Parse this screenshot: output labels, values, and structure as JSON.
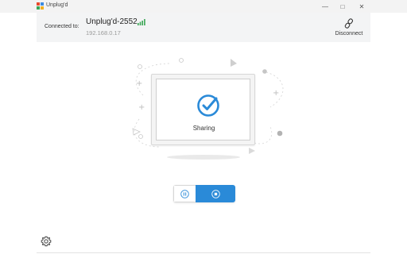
{
  "window": {
    "title": "Unplug'd",
    "logo_colors": [
      "#e8492e",
      "#3d8be0",
      "#3aa655",
      "#f2b01e"
    ],
    "minimize_icon": "minimize-icon",
    "maximize_icon": "maximize-icon",
    "close_icon": "close-icon"
  },
  "header": {
    "connected_label": "Connected to:",
    "device_name": "Unplug'd-2552",
    "ip_address": "192.168.0.17",
    "signal_icon": "signal-strength-icon",
    "signal_color": "#3aa655",
    "disconnect_label": "Disconnect",
    "disconnect_icon": "unlink-icon"
  },
  "main": {
    "status_text": "Sharing",
    "status_icon": "check-circle-icon",
    "accent_color": "#2a8ad8"
  },
  "controls": {
    "pause_icon": "pause-icon",
    "stop_icon": "stop-icon"
  },
  "footer": {
    "settings_icon": "gear-icon"
  }
}
